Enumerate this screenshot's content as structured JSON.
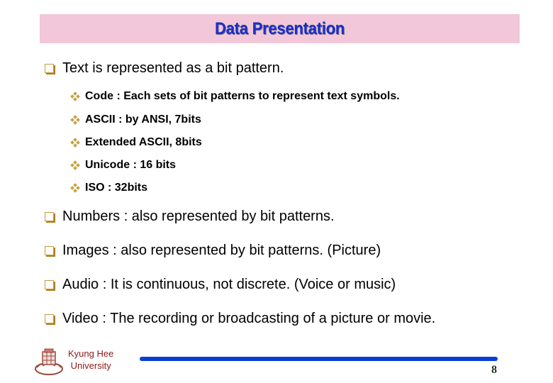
{
  "slide": {
    "title": "Data Presentation",
    "title_bar_color": "#f1c7d9",
    "title_text_color": "#1a2fc4"
  },
  "bullets": [
    {
      "text": "Text is represented as a bit pattern.",
      "sub_items": [
        "Code : Each sets of bit patterns to represent text symbols.",
        "ASCII : by ANSI, 7bits",
        "Extended ASCII, 8bits",
        "Unicode : 16 bits",
        "ISO : 32bits"
      ]
    },
    {
      "text": "Numbers : also represented by bit patterns."
    },
    {
      "text": "Images : also represented by bit patterns. (Picture)"
    },
    {
      "text": "Audio : It is continuous, not discrete. (Voice or music)"
    },
    {
      "text": "Video : The recording or broadcasting of a picture or movie."
    }
  ],
  "footer": {
    "university_line1": "Kyung Hee",
    "university_line2": "University",
    "logo_icon": "university-emblem-icon",
    "page_number": "8",
    "accent_line_color": "#0a3fd6"
  }
}
